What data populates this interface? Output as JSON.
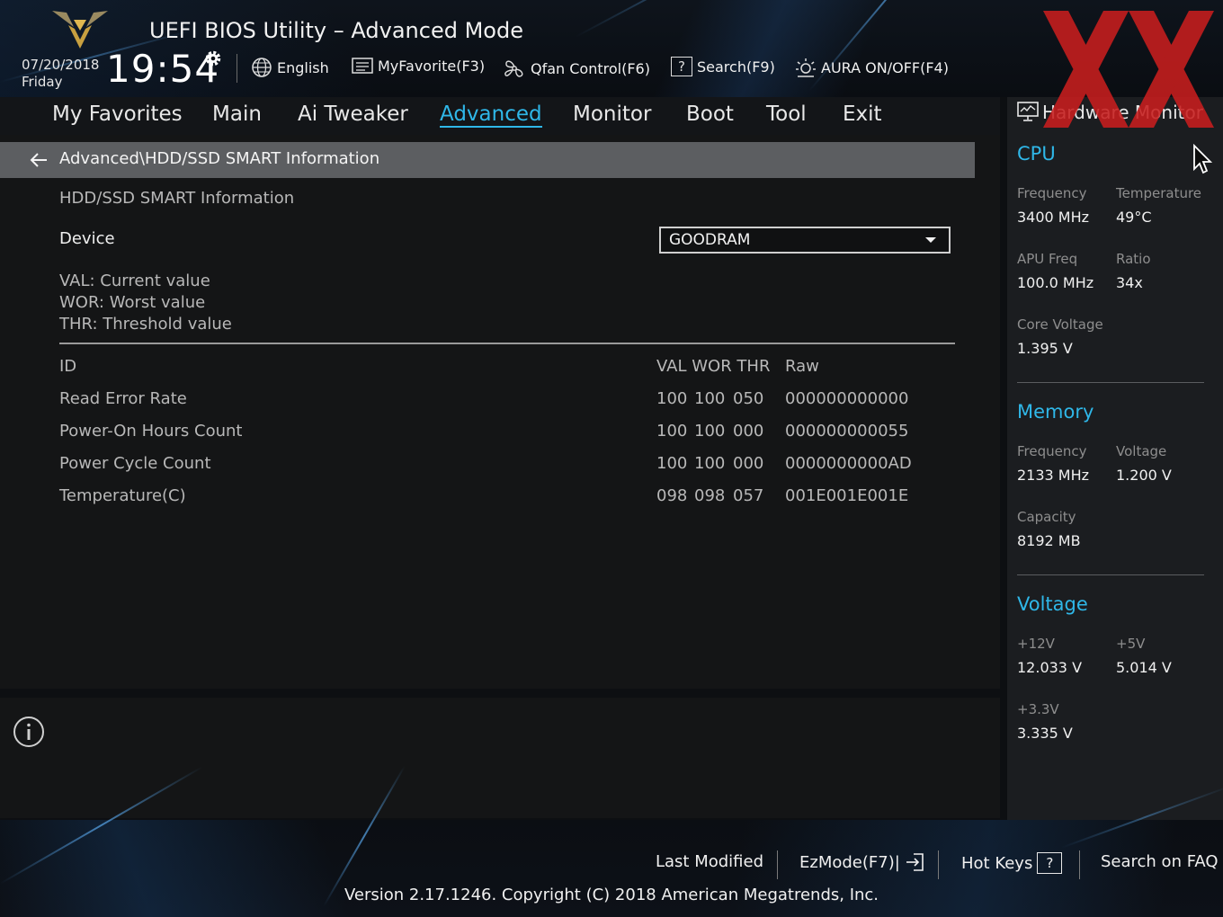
{
  "header": {
    "title": "UEFI BIOS Utility – Advanced Mode",
    "date": "07/20/2018",
    "day": "Friday",
    "time": "19:54",
    "toolbar": [
      {
        "label": "English",
        "icon": "globe-icon"
      },
      {
        "label": "MyFavorite(F3)",
        "icon": "favorite-list-icon"
      },
      {
        "label": "Qfan Control(F6)",
        "icon": "fan-icon"
      },
      {
        "label": "Search(F9)",
        "icon": "search-help-icon"
      },
      {
        "label": "AURA ON/OFF(F4)",
        "icon": "aura-light-icon"
      }
    ]
  },
  "nav": {
    "tabs": [
      "My Favorites",
      "Main",
      "Ai Tweaker",
      "Advanced",
      "Monitor",
      "Boot",
      "Tool",
      "Exit"
    ],
    "active": "Advanced"
  },
  "main": {
    "breadcrumb": "Advanced\\HDD/SSD SMART Information",
    "section_title": "HDD/SSD SMART Information",
    "device_label": "Device",
    "device_value": "GOODRAM",
    "legend": [
      "VAL:  Current value",
      "WOR: Worst value",
      "THR:  Threshold value"
    ],
    "table": {
      "headers": {
        "id": "ID",
        "vals": "VAL WOR THR",
        "raw": "Raw"
      },
      "rows": [
        {
          "name": "Read Error Rate",
          "val": "100",
          "wor": "100",
          "thr": "050",
          "raw": "000000000000"
        },
        {
          "name": "Power-On Hours Count",
          "val": "100",
          "wor": "100",
          "thr": "000",
          "raw": "000000000055"
        },
        {
          "name": "Power Cycle Count",
          "val": "100",
          "wor": "100",
          "thr": "000",
          "raw": "0000000000AD"
        },
        {
          "name": "Temperature(C)",
          "val": "098",
          "wor": "098",
          "thr": "057",
          "raw": "001E001E001E"
        }
      ]
    }
  },
  "hw_monitor": {
    "title": "Hardware Monitor",
    "cpu": {
      "heading": "CPU",
      "frequency_label": "Frequency",
      "frequency": "3400 MHz",
      "temperature_label": "Temperature",
      "temperature": "49°C",
      "apu_label": "APU Freq",
      "apu": "100.0 MHz",
      "ratio_label": "Ratio",
      "ratio": "34x",
      "core_voltage_label": "Core Voltage",
      "core_voltage": "1.395 V"
    },
    "memory": {
      "heading": "Memory",
      "frequency_label": "Frequency",
      "frequency": "2133 MHz",
      "voltage_label": "Voltage",
      "voltage": "1.200 V",
      "capacity_label": "Capacity",
      "capacity": "8192 MB"
    },
    "voltage": {
      "heading": "Voltage",
      "v12_label": "+12V",
      "v12": "12.033 V",
      "v5_label": "+5V",
      "v5": "5.014 V",
      "v33_label": "+3.3V",
      "v33": "3.335 V"
    }
  },
  "footer": {
    "last_modified": "Last Modified",
    "ezmode": "EzMode(F7)|",
    "hotkeys": "Hot Keys",
    "hotkeys_key": "?",
    "faq": "Search on FAQ",
    "version": "Version 2.17.1246. Copyright (C) 2018 American Megatrends, Inc."
  },
  "colors": {
    "accent": "#2fb7e8",
    "watermark": "#c81e1e"
  }
}
